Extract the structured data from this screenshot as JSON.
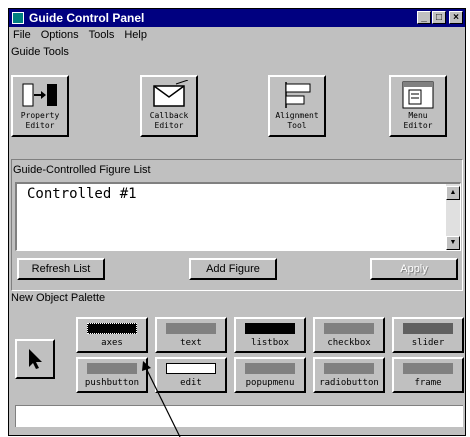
{
  "window": {
    "title": "Guide Control Panel",
    "minimize": "_",
    "maximize": "□",
    "close": "×"
  },
  "menu": [
    "File",
    "Options",
    "Tools",
    "Help"
  ],
  "guide_tools": {
    "heading": "Guide Tools",
    "tools": [
      {
        "line1": "Property",
        "line2": "Editor",
        "icon": "property-editor-icon"
      },
      {
        "line1": "Callback",
        "line2": "Editor",
        "icon": "callback-editor-icon"
      },
      {
        "line1": "Alignment",
        "line2": "Tool",
        "icon": "alignment-tool-icon"
      },
      {
        "line1": "Menu",
        "line2": "Editor",
        "icon": "menu-editor-icon"
      }
    ]
  },
  "figure_list": {
    "heading": "Guide-Controlled Figure List",
    "items": [
      "Controlled  #1"
    ],
    "buttons": {
      "refresh": "Refresh List",
      "add": "Add Figure",
      "apply": "Apply"
    }
  },
  "palette": {
    "heading": "New Object Palette",
    "row1": [
      "axes",
      "text",
      "listbox",
      "checkbox",
      "slider"
    ],
    "row2": [
      "pushbutton",
      "edit",
      "popupmenu",
      "radiobutton",
      "frame"
    ]
  }
}
